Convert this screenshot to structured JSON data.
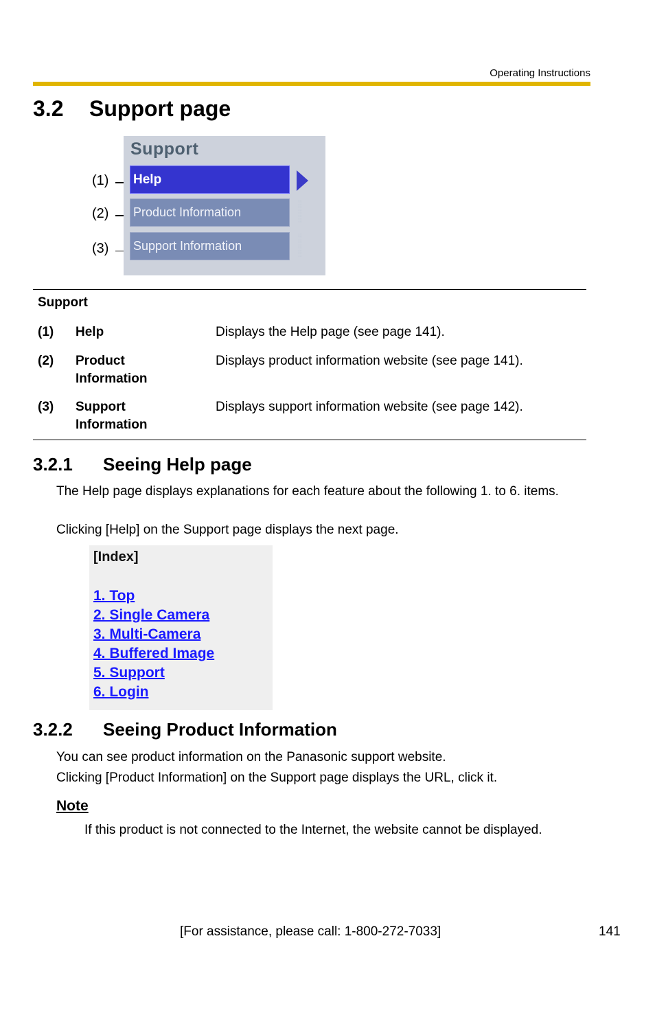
{
  "header": {
    "running_title": "Operating Instructions",
    "rule_color": "#e0b400"
  },
  "section": {
    "number": "3.2",
    "title": "Support page"
  },
  "support_menu_screenshot": {
    "title": "Support",
    "items": [
      {
        "callout": "(1)",
        "label": "Help",
        "active": true
      },
      {
        "callout": "(2)",
        "label": "Product Information",
        "active": false
      },
      {
        "callout": "(3)",
        "label": "Support Information",
        "active": false
      }
    ],
    "active_color": "#3434cf",
    "inactive_color": "#7a8cb5",
    "background_color": "#cdd2dc"
  },
  "table": {
    "heading": "Support",
    "rows": [
      {
        "num": "(1)",
        "name": "Help",
        "description": "Displays the Help page (see page 141)."
      },
      {
        "num": "(2)",
        "name": "Product Information",
        "name_lines": [
          "Product",
          "Information"
        ],
        "description": "Displays product information website (see page 141)."
      },
      {
        "num": "(3)",
        "name": "Support Information",
        "name_lines": [
          "Support",
          "Information"
        ],
        "description": "Displays support information website (see page 142)."
      }
    ]
  },
  "subsection_1": {
    "number": "3.2.1",
    "title": "Seeing Help page",
    "paragraph_1": "The Help page displays explanations for each feature about the following 1. to 6. items.",
    "paragraph_2": "Clicking [Help] on the Support page displays the next page.",
    "index_screenshot": {
      "title": "[Index]",
      "links": [
        "1. Top",
        "2. Single Camera",
        "3. Multi-Camera",
        "4. Buffered Image",
        "5. Support",
        "6. Login"
      ],
      "link_color": "#1a1aff"
    }
  },
  "subsection_2": {
    "number": "3.2.2",
    "title": "Seeing Product Information",
    "paragraph_1": "You can see product information on the Panasonic support website.",
    "paragraph_2": "Clicking [Product Information] on the Support page displays the URL, click it."
  },
  "note": {
    "title": "Note",
    "body": "If this product is not connected to the Internet, the website cannot be displayed."
  },
  "footer": {
    "assistance": "[For assistance, please call: 1-800-272-7033]",
    "page_number": "141"
  }
}
